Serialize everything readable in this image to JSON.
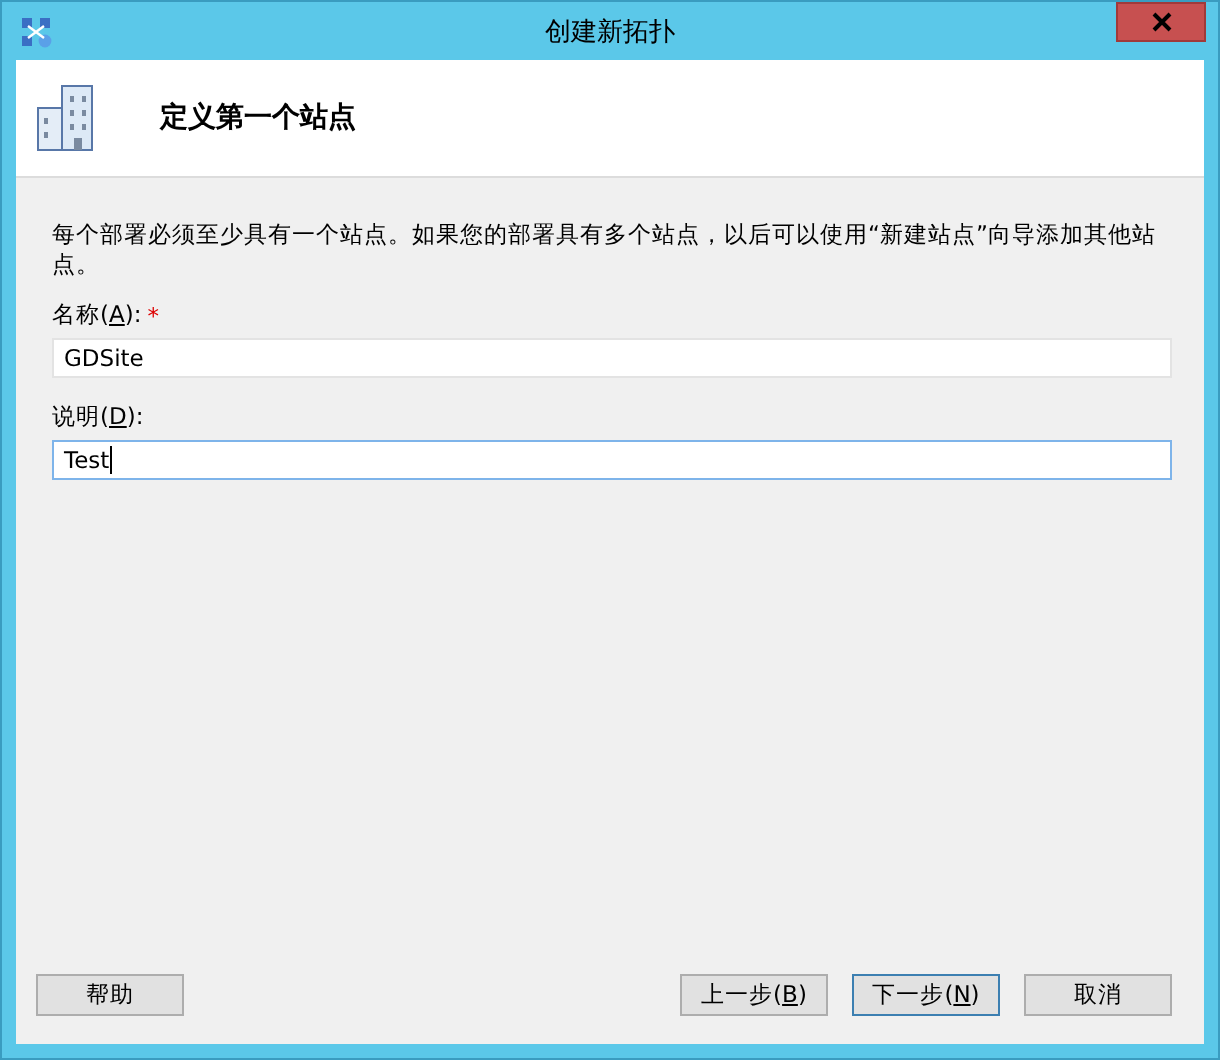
{
  "window": {
    "title": "创建新拓扑"
  },
  "header": {
    "title": "定义第一个站点"
  },
  "description": "每个部署必须至少具有一个站点。如果您的部署具有多个站点，以后可以使用“新建站点”向导添加其他站点。",
  "fields": [
    {
      "label": {
        "before": "名称(",
        "key": "A",
        "after": "):"
      },
      "required_mark": "*",
      "value": "GDSite",
      "focused": false
    },
    {
      "label": {
        "before": "说明(",
        "key": "D",
        "after": "):"
      },
      "value": "Test",
      "focused": true
    }
  ],
  "help_button": {
    "label": {
      "before": "帮助"
    },
    "default": false
  },
  "buttons": [
    {
      "label": {
        "before": "上一步(",
        "key": "B",
        "after": ")"
      },
      "default": false
    },
    {
      "label": {
        "before": "下一步(",
        "key": "N",
        "after": ")"
      },
      "default": true
    },
    {
      "label": {
        "before": "取消"
      },
      "default": false
    }
  ]
}
